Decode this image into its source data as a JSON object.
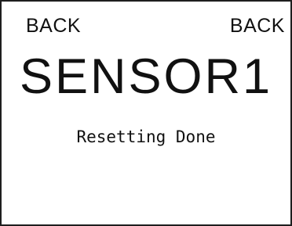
{
  "softkeys": {
    "left_label": "BACK",
    "right_label": "BACK"
  },
  "screen": {
    "title": "SENSOR1",
    "status": "Resetting Done"
  }
}
